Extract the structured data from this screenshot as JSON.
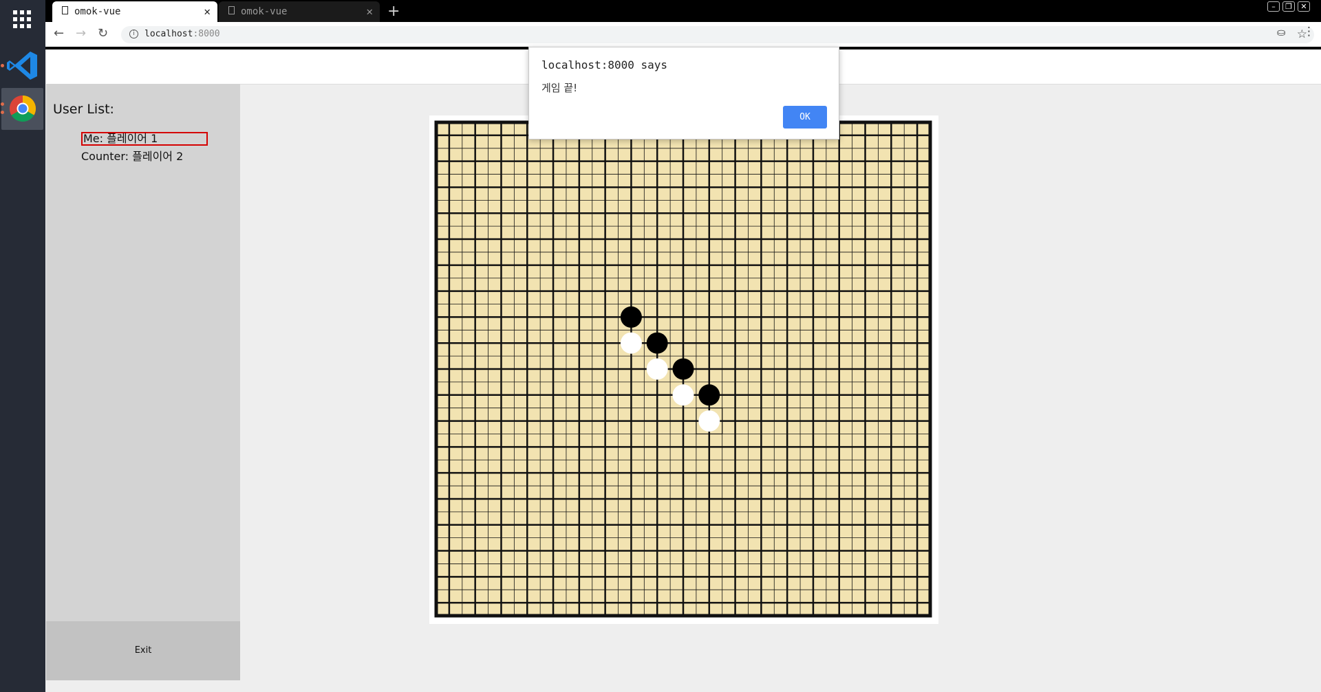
{
  "browser": {
    "tabs": [
      {
        "title": "omok-vue",
        "active": true
      },
      {
        "title": "omok-vue",
        "active": false
      }
    ],
    "url_host": "localhost",
    "url_port": ":8000"
  },
  "sidebar": {
    "title": "User List:",
    "me": "Me: 플레이어 1",
    "counter": "Counter: 플레이어 2",
    "exit_label": "Exit"
  },
  "alert": {
    "title": "localhost:8000 says",
    "message": "게임 끝!",
    "ok_label": "OK"
  },
  "board": {
    "size": 19,
    "colors": {
      "board": "#f2e3b1",
      "line": "#111111",
      "black": "#000000",
      "white": "#ffffff"
    },
    "stones": [
      {
        "col": 7,
        "row": 7,
        "color": "black"
      },
      {
        "col": 7,
        "row": 8,
        "color": "white"
      },
      {
        "col": 8,
        "row": 8,
        "color": "black"
      },
      {
        "col": 8,
        "row": 9,
        "color": "white"
      },
      {
        "col": 9,
        "row": 9,
        "color": "black"
      },
      {
        "col": 9,
        "row": 10,
        "color": "white"
      },
      {
        "col": 10,
        "row": 10,
        "color": "black"
      },
      {
        "col": 10,
        "row": 11,
        "color": "white"
      }
    ],
    "last_move": {
      "col": 10,
      "row": 11
    }
  },
  "colors": {
    "accent": "#4285f4",
    "highlight_border": "#d40000"
  }
}
